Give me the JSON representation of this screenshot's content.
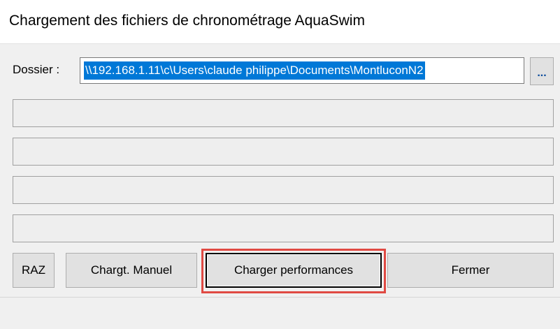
{
  "window": {
    "title": "Chargement des fichiers de chronométrage AquaSwim"
  },
  "folder": {
    "label": "Dossier :",
    "value": "\\\\192.168.1.11\\c\\Users\\claude philippe\\Documents\\MontluconN2",
    "browse_label": "..."
  },
  "status_lines": [
    "",
    "",
    "",
    "",
    ""
  ],
  "buttons": {
    "reset": "RAZ",
    "manual_load": "Chargt. Manuel",
    "load_performances": "Charger performances",
    "close": "Fermer"
  },
  "colors": {
    "selection": "#0078d7",
    "highlight": "#e04a43"
  }
}
